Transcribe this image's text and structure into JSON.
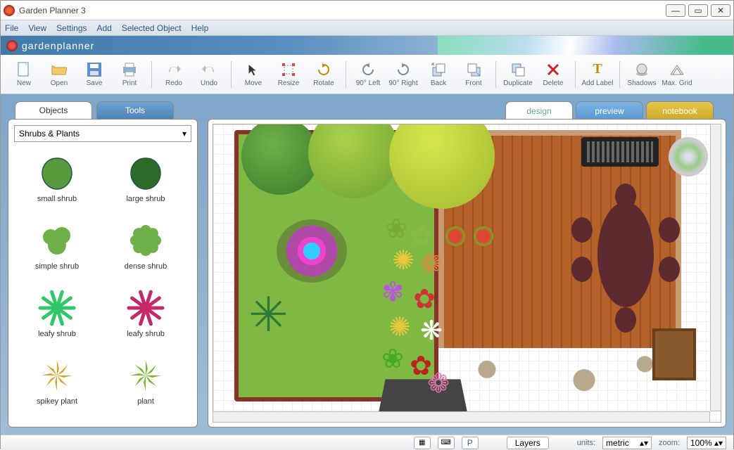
{
  "window": {
    "title": "Garden Planner 3"
  },
  "menu": {
    "file": "File",
    "view": "View",
    "settings": "Settings",
    "add": "Add",
    "selected": "Selected Object",
    "help": "Help"
  },
  "brand": "gardenplanner",
  "toolbar": {
    "new": "New",
    "open": "Open",
    "save": "Save",
    "print": "Print",
    "redo": "Redo",
    "undo": "Undo",
    "move": "Move",
    "resize": "Resize",
    "rotate": "Rotate",
    "rotleft": "90° Left",
    "rotright": "90° Right",
    "back": "Back",
    "front": "Front",
    "dup": "Duplicate",
    "del": "Delete",
    "addlabel": "Add Label",
    "shadows": "Shadows",
    "maxgrid": "Max. Grid"
  },
  "sidetabs": {
    "objects": "Objects",
    "tools": "Tools"
  },
  "category": "Shrubs & Plants",
  "palette": [
    {
      "label": "small shrub",
      "color": "#5a9a3e",
      "shape": "bush"
    },
    {
      "label": "large shrub",
      "color": "#2e6a28",
      "shape": "bush"
    },
    {
      "label": "simple shrub",
      "color": "#6fb048",
      "shape": "cloud"
    },
    {
      "label": "dense shrub",
      "color": "#6fb048",
      "shape": "dense"
    },
    {
      "label": "leafy shrub",
      "color": "#2ec76a",
      "shape": "leafy"
    },
    {
      "label": "leafy shrub",
      "color": "#c4286a",
      "shape": "leafy"
    },
    {
      "label": "spikey plant",
      "color": "#d8a828",
      "shape": "spike"
    },
    {
      "label": "plant",
      "color": "#7ab82e",
      "shape": "spike"
    }
  ],
  "canvastabs": {
    "design": "design",
    "preview": "preview",
    "notebook": "notebook"
  },
  "status": {
    "layers": "Layers",
    "units_lbl": "units:",
    "units": "metric",
    "zoom_lbl": "zoom:",
    "zoom": "100%",
    "p": "P"
  }
}
